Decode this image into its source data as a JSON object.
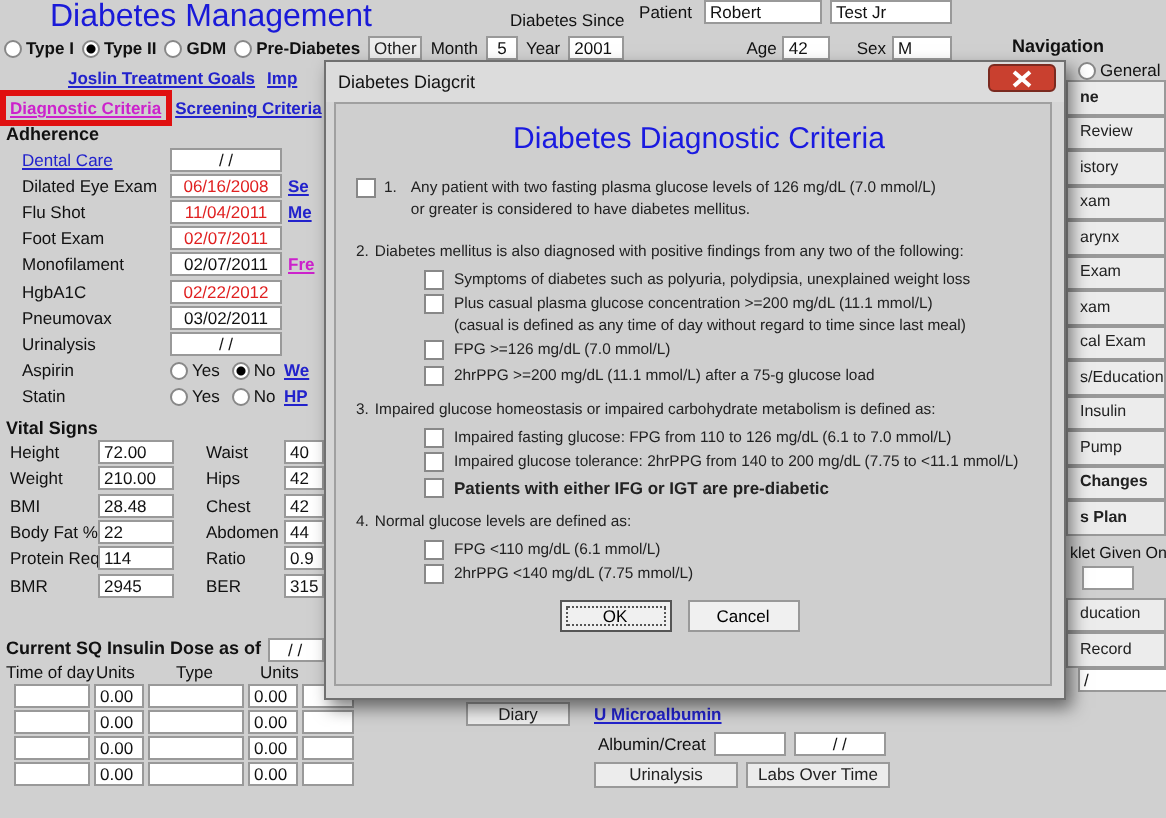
{
  "app": {
    "title": "Diabetes Management",
    "since_label": "Diabetes Since"
  },
  "patient": {
    "label": "Patient",
    "first": "Robert",
    "last": "Test Jr",
    "age_label": "Age",
    "age": "42",
    "sex_label": "Sex",
    "sex": "M"
  },
  "diabetes_types": [
    {
      "label": "Type I",
      "selected": false
    },
    {
      "label": "Type II",
      "selected": true
    },
    {
      "label": "GDM",
      "selected": false
    },
    {
      "label": "Pre-Diabetes",
      "selected": false
    }
  ],
  "other_button": "Other",
  "month_label": "Month",
  "month": "5",
  "year_label": "Year",
  "year": "2001",
  "link_rows": [
    [
      {
        "label": "Joslin Treatment Goals",
        "visited": false,
        "highlighted": false
      },
      {
        "label": "Imp",
        "visited": false,
        "highlighted": false
      }
    ],
    [
      {
        "label": "Diagnostic Criteria",
        "visited": true,
        "highlighted": true
      },
      {
        "label": "Screening Criteria",
        "visited": false,
        "highlighted": false
      }
    ]
  ],
  "adherence": {
    "title": "Adherence",
    "rows": [
      {
        "kind": "date",
        "label": "Dental Care",
        "is_link": true,
        "date": "/ /",
        "overdue": false
      },
      {
        "kind": "date",
        "label": "Dilated Eye Exam",
        "is_link": false,
        "date": "06/16/2008",
        "overdue": true,
        "side_link": {
          "label": "Se",
          "visited": false
        }
      },
      {
        "kind": "date",
        "label": "Flu Shot",
        "is_link": false,
        "date": "11/04/2011",
        "overdue": true,
        "side_link": {
          "label": "Me",
          "visited": false
        }
      },
      {
        "kind": "date",
        "label": "Foot Exam",
        "is_link": false,
        "date": "02/07/2011",
        "overdue": true
      },
      {
        "kind": "date",
        "label": "Monofilament",
        "is_link": false,
        "date": "02/07/2011",
        "overdue": false,
        "side_link": {
          "label": "Fre",
          "visited": true
        }
      },
      {
        "kind": "date",
        "label": "HgbA1C",
        "is_link": false,
        "date": "02/22/2012",
        "overdue": true
      },
      {
        "kind": "date",
        "label": "Pneumovax",
        "is_link": false,
        "date": "03/02/2011",
        "overdue": false
      },
      {
        "kind": "date",
        "label": "Urinalysis",
        "is_link": false,
        "date": "/ /",
        "overdue": false
      },
      {
        "kind": "choice",
        "label": "Aspirin",
        "is_link": false,
        "options": [
          {
            "label": "Yes",
            "selected": false
          },
          {
            "label": "No",
            "selected": true
          }
        ],
        "side_link": {
          "label": "We",
          "visited": false
        }
      },
      {
        "kind": "choice",
        "label": "Statin",
        "is_link": false,
        "options": [
          {
            "label": "Yes",
            "selected": false
          },
          {
            "label": "No",
            "selected": false
          }
        ],
        "side_link": {
          "label": "HP",
          "visited": false
        }
      }
    ]
  },
  "vitals": {
    "title": "Vital Signs",
    "left": [
      {
        "label": "Height",
        "value": "72.00"
      },
      {
        "label": "Weight",
        "value": "210.00"
      },
      {
        "label": "BMI",
        "value": "28.48"
      },
      {
        "label": "Body Fat %",
        "value": "22"
      },
      {
        "label": "Protein Req",
        "value": "114"
      },
      {
        "label": "BMR",
        "value": "2945"
      }
    ],
    "right": [
      {
        "label": "Waist",
        "value": "40"
      },
      {
        "label": "Hips",
        "value": "42"
      },
      {
        "label": "Chest",
        "value": "42"
      },
      {
        "label": "Abdomen",
        "value": "44"
      },
      {
        "label": "Ratio",
        "value": "0.9"
      },
      {
        "label": "BER",
        "value": "315"
      }
    ]
  },
  "insulin": {
    "title": "Current SQ Insulin Dose as of",
    "date": "/ /",
    "columns": [
      "Time of day",
      "Units",
      "Type",
      "Units"
    ],
    "rows": [
      {
        "units_1": "0.00",
        "units_2": "0.00"
      },
      {
        "units_1": "0.00",
        "units_2": "0.00"
      },
      {
        "units_1": "0.00",
        "units_2": "0.00"
      },
      {
        "units_1": "0.00",
        "units_2": "0.00"
      }
    ]
  },
  "labs": {
    "diary_button": "Diary",
    "microalbumin_link": "U Microalbumin",
    "albumin_label": "Albumin/Creat",
    "albumin_date": "/ /",
    "buttons": [
      "Urinalysis",
      "Labs Over Time"
    ]
  },
  "navigation": {
    "title": "Navigation",
    "general": {
      "label": "General",
      "selected": false
    },
    "buttons": [
      {
        "label": "ne",
        "bold": true
      },
      {
        "label": "Review",
        "bold": false
      },
      {
        "label": "istory",
        "bold": false
      },
      {
        "label": "xam",
        "bold": false
      },
      {
        "label": "arynx",
        "bold": false
      },
      {
        "label": "Exam",
        "bold": false
      },
      {
        "label": "xam",
        "bold": false
      },
      {
        "label": "cal Exam",
        "bold": false
      },
      {
        "label": "s/Education",
        "bold": false
      },
      {
        "label": "Insulin",
        "bold": false
      },
      {
        "label": "Pump",
        "bold": false
      },
      {
        "label": "Changes",
        "bold": true
      },
      {
        "label": "s Plan",
        "bold": true
      }
    ],
    "booklet_label": "klet Given On",
    "lower_buttons": [
      {
        "label": "ducation",
        "bold": false
      },
      {
        "label": "Record",
        "bold": false
      }
    ],
    "record_date": "/"
  },
  "dialog": {
    "title": "Diabetes Diagcrit",
    "heading": "Diabetes Diagnostic Criteria",
    "sections": [
      {
        "kind": "check",
        "number": "1.",
        "lines": [
          "Any patient with two fasting plasma glucose levels of 126 mg/dL (7.0 mmol/L)",
          "or greater is considered to have diabetes mellitus."
        ],
        "checked": false
      },
      {
        "kind": "group",
        "number": "2.",
        "text": "Diabetes mellitus is also diagnosed with positive findings from any two of the following:",
        "items": [
          {
            "lines": [
              "Symptoms of diabetes such as polyuria, polydipsia, unexplained weight loss"
            ],
            "checked": false,
            "bold": false
          },
          {
            "lines": [
              "Plus casual plasma glucose concentration >=200 mg/dL (11.1 mmol/L)",
              "(casual is defined as any time of day without regard to time since last meal)"
            ],
            "checked": false,
            "bold": false
          },
          {
            "lines": [
              "FPG >=126 mg/dL (7.0 mmol/L)"
            ],
            "checked": false,
            "bold": false
          },
          {
            "lines": [
              "2hrPPG >=200 mg/dL (11.1 mmol/L) after a 75-g glucose load"
            ],
            "checked": false,
            "bold": false
          }
        ]
      },
      {
        "kind": "group",
        "number": "3.",
        "text": "Impaired glucose homeostasis or impaired carbohydrate metabolism is defined as:",
        "items": [
          {
            "lines": [
              "Impaired fasting glucose: FPG from 110 to 126 mg/dL (6.1 to 7.0 mmol/L)"
            ],
            "checked": false,
            "bold": false
          },
          {
            "lines": [
              "Impaired glucose tolerance: 2hrPPG from 140 to 200 mg/dL (7.75 to <11.1 mmol/L)"
            ],
            "checked": false,
            "bold": false
          },
          {
            "lines": [
              "Patients with either IFG or IGT are pre-diabetic"
            ],
            "checked": false,
            "bold": true
          }
        ]
      },
      {
        "kind": "group",
        "number": "4.",
        "text": "Normal glucose levels are defined as:",
        "items": [
          {
            "lines": [
              "FPG <110 mg/dL (6.1 mmol/L)"
            ],
            "checked": false,
            "bold": false
          },
          {
            "lines": [
              "2hrPPG <140 mg/dL (7.75 mmol/L)"
            ],
            "checked": false,
            "bold": false
          }
        ]
      }
    ],
    "buttons": [
      {
        "label": "OK",
        "default": true
      },
      {
        "label": "Cancel",
        "default": false
      }
    ]
  }
}
